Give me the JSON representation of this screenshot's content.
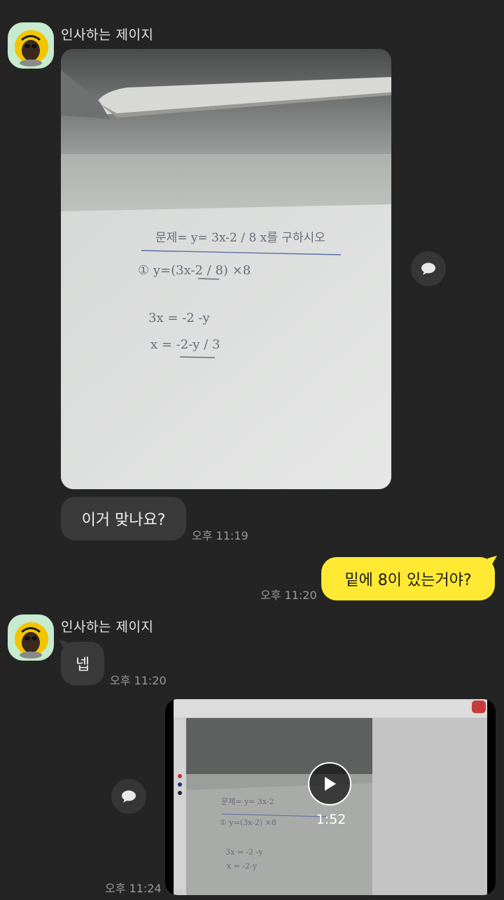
{
  "messages": {
    "first": {
      "sender": "인사하는 제이지",
      "text": "이거 맞나요?",
      "time": "오후 11:19"
    },
    "reply": {
      "text": "밑에 8이 있는거야?",
      "time": "오후 11:20"
    },
    "second": {
      "sender": "인사하는 제이지",
      "text": "넵",
      "time": "오후 11:20"
    },
    "video": {
      "duration": "1:52",
      "time": "오후 11:24"
    }
  },
  "photo_handwriting": {
    "line1": "문제= y= 3x-2 / 8   x를 구하시오",
    "line2": "① y=(3x-2 / 8) ×8",
    "line3": "3x = -2 -y",
    "line4": "x = -2-y / 3"
  },
  "colors": {
    "background": "#242424",
    "incoming_bubble": "#3a3a3a",
    "outgoing_bubble": "#ffe933",
    "avatar_bg": "#c6ebcf"
  },
  "icons": [
    "speech-bubble-icon",
    "play-icon",
    "avatar-character-icon"
  ]
}
